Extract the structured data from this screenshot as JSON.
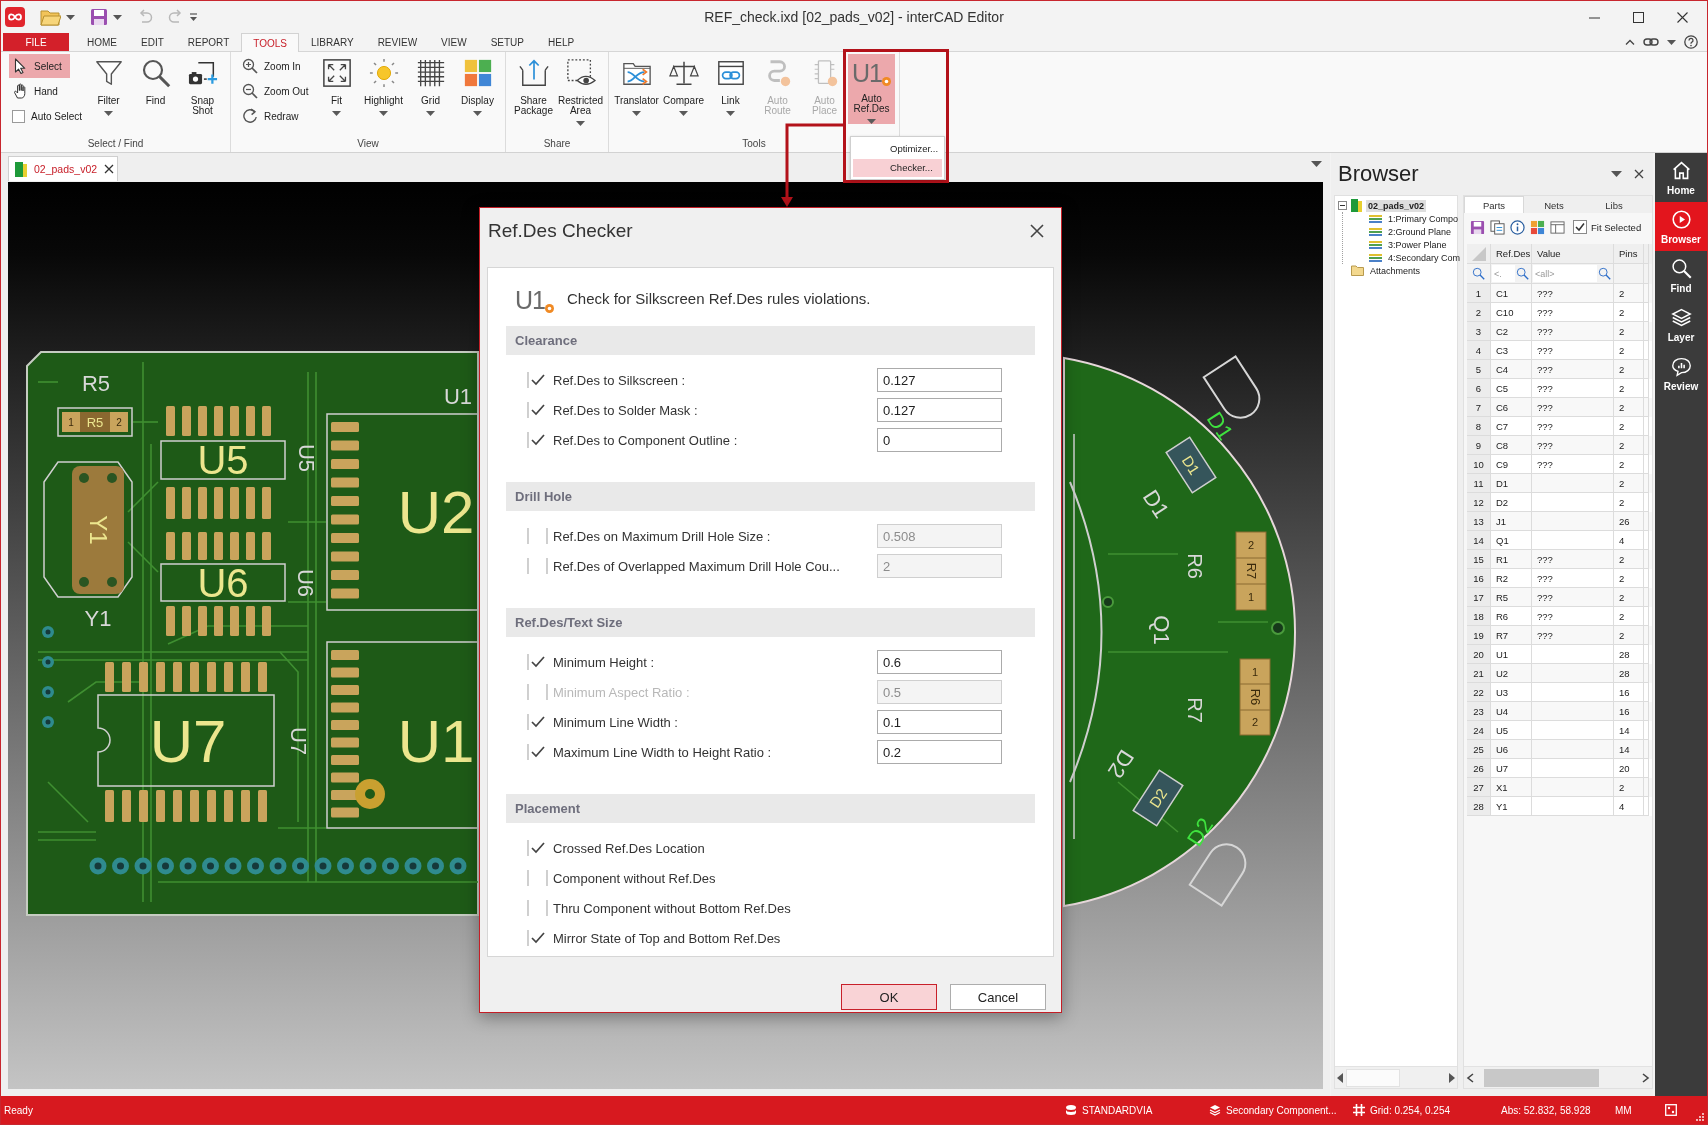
{
  "window": {
    "title": "REF_check.ixd [02_pads_v02] - interCAD Editor"
  },
  "quick_access": {
    "undo": {
      "disabled": true
    },
    "redo": {
      "disabled": true
    }
  },
  "ribbon_tabs": [
    {
      "label": "FILE",
      "kind": "file",
      "selected": false
    },
    {
      "label": "HOME",
      "kind": "tab",
      "selected": false
    },
    {
      "label": "EDIT",
      "kind": "tab",
      "selected": false
    },
    {
      "label": "REPORT",
      "kind": "tab",
      "selected": false
    },
    {
      "label": "TOOLS",
      "kind": "tab",
      "selected": true
    },
    {
      "label": "LIBRARY",
      "kind": "tab",
      "selected": false
    },
    {
      "label": "REVIEW",
      "kind": "tab",
      "selected": false
    },
    {
      "label": "VIEW",
      "kind": "tab",
      "selected": false
    },
    {
      "label": "SETUP",
      "kind": "tab",
      "selected": false
    },
    {
      "label": "HELP",
      "kind": "tab",
      "selected": false
    }
  ],
  "ribbon_groups": [
    {
      "label": "Select / Find",
      "items": [
        {
          "kind": "small",
          "label": "Select",
          "selected": true
        },
        {
          "kind": "small",
          "label": "Hand",
          "selected": false
        },
        {
          "kind": "checkbox",
          "label": "Auto Select",
          "checked": false
        },
        {
          "kind": "large",
          "label": "Filter",
          "dropdown": true,
          "expanded": false,
          "disabled": false
        },
        {
          "kind": "large",
          "label": "Find",
          "dropdown": false,
          "expanded": false,
          "disabled": false
        },
        {
          "kind": "large",
          "label": "Snap Shot",
          "dropdown": false,
          "expanded": false,
          "disabled": false
        }
      ]
    },
    {
      "label": "View",
      "items": [
        {
          "kind": "small",
          "label": "Zoom In"
        },
        {
          "kind": "small",
          "label": "Zoom Out"
        },
        {
          "kind": "small",
          "label": "Redraw"
        },
        {
          "kind": "large",
          "label": "Fit",
          "dropdown": true,
          "expanded": false,
          "disabled": false
        },
        {
          "kind": "large",
          "label": "Highlight",
          "dropdown": true,
          "expanded": false,
          "disabled": false
        },
        {
          "kind": "large",
          "label": "Grid",
          "dropdown": true,
          "expanded": false,
          "disabled": false
        },
        {
          "kind": "large",
          "label": "Display",
          "dropdown": true,
          "expanded": false,
          "disabled": false
        }
      ]
    },
    {
      "label": "Share",
      "items": [
        {
          "kind": "large",
          "label": "Share Package",
          "dropdown": false,
          "expanded": false,
          "disabled": false
        },
        {
          "kind": "large",
          "label": "Restricted Area",
          "dropdown": true,
          "expanded": false,
          "disabled": false
        }
      ]
    },
    {
      "label": "Tools",
      "items": [
        {
          "kind": "large",
          "label": "Translator",
          "dropdown": true,
          "expanded": false,
          "disabled": false
        },
        {
          "kind": "large",
          "label": "Compare",
          "dropdown": true,
          "expanded": false,
          "disabled": false
        },
        {
          "kind": "large",
          "label": "Link",
          "dropdown": true,
          "expanded": false,
          "disabled": false
        },
        {
          "kind": "large",
          "label": "Auto Route",
          "dropdown": false,
          "expanded": false,
          "disabled": true
        },
        {
          "kind": "large",
          "label": "Auto Place",
          "dropdown": false,
          "expanded": false,
          "disabled": true
        },
        {
          "kind": "large",
          "label": "Auto Ref.Des",
          "glyph": "U1",
          "dropdown": true,
          "expanded": true,
          "disabled": false
        }
      ]
    }
  ],
  "ref_des_menu": {
    "items": [
      {
        "label": "Optimizer...",
        "selected": false
      },
      {
        "label": "Checker...",
        "selected": true
      }
    ]
  },
  "document_tabs": [
    {
      "label": "02_pads_v02",
      "selected": true
    }
  ],
  "board_labels": [
    {
      "text": "R5",
      "kind": "silkscreen"
    },
    {
      "text": "1",
      "kind": "pad"
    },
    {
      "text": "R5",
      "kind": "assembly"
    },
    {
      "text": "2",
      "kind": "pad"
    },
    {
      "text": "U5",
      "kind": "assembly"
    },
    {
      "text": "U5",
      "kind": "silkscreen"
    },
    {
      "text": "U1",
      "kind": "silkscreen"
    },
    {
      "text": "U2",
      "kind": "assembly"
    },
    {
      "text": "Y1",
      "kind": "assembly"
    },
    {
      "text": "Y1",
      "kind": "silkscreen"
    },
    {
      "text": "U6",
      "kind": "assembly"
    },
    {
      "text": "U6",
      "kind": "silkscreen"
    },
    {
      "text": "U7",
      "kind": "assembly"
    },
    {
      "text": "U7",
      "kind": "silkscreen"
    },
    {
      "text": "U1",
      "kind": "assembly"
    },
    {
      "text": "D1",
      "kind": "highlight"
    },
    {
      "text": "D1",
      "kind": "assembly"
    },
    {
      "text": "D1",
      "kind": "silkscreen"
    },
    {
      "text": "R6",
      "kind": "silkscreen"
    },
    {
      "text": "2",
      "kind": "pad"
    },
    {
      "text": "R7",
      "kind": "pad"
    },
    {
      "text": "1",
      "kind": "pad"
    },
    {
      "text": "Q1",
      "kind": "silkscreen"
    },
    {
      "text": "1",
      "kind": "pad"
    },
    {
      "text": "R6",
      "kind": "pad"
    },
    {
      "text": "2",
      "kind": "pad"
    },
    {
      "text": "R7",
      "kind": "silkscreen"
    },
    {
      "text": "D2",
      "kind": "silkscreen"
    },
    {
      "text": "D2",
      "kind": "assembly"
    },
    {
      "text": "D2",
      "kind": "highlight"
    }
  ],
  "dialog": {
    "title": "Ref.Des Checker",
    "glyph": "U1",
    "intro": "Check for Silkscreen Ref.Des rules violations.",
    "sections": [
      {
        "title": "Clearance",
        "rules": [
          {
            "label": "Ref.Des to Silkscreen :",
            "checked": true,
            "disabled": false,
            "value": "0.127"
          },
          {
            "label": "Ref.Des to Solder Mask :",
            "checked": true,
            "disabled": false,
            "value": "0.127"
          },
          {
            "label": "Ref.Des to Component Outline :",
            "checked": true,
            "disabled": false,
            "value": "0"
          }
        ]
      },
      {
        "title": "Drill Hole",
        "rules": [
          {
            "label": "Ref.Des on Maximum Drill Hole Size :",
            "checked": false,
            "disabled": false,
            "value": "0.508"
          },
          {
            "label": "Ref.Des of Overlapped Maximum Drill Hole Cou...",
            "checked": false,
            "disabled": false,
            "value": "2"
          }
        ]
      },
      {
        "title": "Ref.Des/Text Size",
        "rules": [
          {
            "label": "Minimum Height :",
            "checked": true,
            "disabled": false,
            "value": "0.6"
          },
          {
            "label": "Minimum Aspect Ratio :",
            "checked": false,
            "disabled": true,
            "value": "0.5"
          },
          {
            "label": "Minimum Line Width :",
            "checked": true,
            "disabled": false,
            "value": "0.1"
          },
          {
            "label": "Maximum Line Width to Height Ratio :",
            "checked": true,
            "disabled": false,
            "value": "0.2"
          }
        ]
      },
      {
        "title": "Placement",
        "rules": [
          {
            "label": "Crossed Ref.Des Location",
            "checked": true,
            "disabled": false
          },
          {
            "label": "Component without Ref.Des",
            "checked": false,
            "disabled": false
          },
          {
            "label": "Thru Component without Bottom Ref.Des",
            "checked": false,
            "disabled": false
          },
          {
            "label": "Mirror State of Top and Bottom Ref.Des",
            "checked": true,
            "disabled": false
          }
        ]
      }
    ],
    "buttons": [
      {
        "label": "OK",
        "kind": "primary"
      },
      {
        "label": "Cancel",
        "kind": "secondary"
      }
    ]
  },
  "browser": {
    "title": "Browser",
    "tree": [
      {
        "label": "02_pads_v02",
        "kind": "document",
        "selected": true,
        "expanded": true,
        "children": [
          {
            "label": "1:Primary Compo",
            "kind": "layer",
            "selected": false
          },
          {
            "label": "2:Ground Plane",
            "kind": "layer",
            "selected": false
          },
          {
            "label": "3:Power Plane",
            "kind": "layer",
            "selected": false
          },
          {
            "label": "4:Secondary Com",
            "kind": "layer",
            "selected": false
          }
        ]
      },
      {
        "label": "Attachments",
        "kind": "folder",
        "selected": false
      }
    ],
    "tabs": [
      {
        "label": "Parts",
        "selected": true
      },
      {
        "label": "Nets",
        "selected": false
      },
      {
        "label": "Libs",
        "selected": false
      }
    ],
    "fit_selected": {
      "label": "Fit Selected",
      "checked": true
    },
    "table": {
      "columns": [
        "Ref.Des",
        "Value",
        "Pins"
      ],
      "filters": [
        {
          "placeholder": "<."
        },
        {
          "placeholder": "<all>"
        }
      ],
      "rows": [
        {
          "number": "1",
          "ref_des": "C1",
          "value": "???",
          "pins": "2"
        },
        {
          "number": "2",
          "ref_des": "C10",
          "value": "???",
          "pins": "2"
        },
        {
          "number": "3",
          "ref_des": "C2",
          "value": "???",
          "pins": "2"
        },
        {
          "number": "4",
          "ref_des": "C3",
          "value": "???",
          "pins": "2"
        },
        {
          "number": "5",
          "ref_des": "C4",
          "value": "???",
          "pins": "2"
        },
        {
          "number": "6",
          "ref_des": "C5",
          "value": "???",
          "pins": "2"
        },
        {
          "number": "7",
          "ref_des": "C6",
          "value": "???",
          "pins": "2"
        },
        {
          "number": "8",
          "ref_des": "C7",
          "value": "???",
          "pins": "2"
        },
        {
          "number": "9",
          "ref_des": "C8",
          "value": "???",
          "pins": "2"
        },
        {
          "number": "10",
          "ref_des": "C9",
          "value": "???",
          "pins": "2"
        },
        {
          "number": "11",
          "ref_des": "D1",
          "pins": "2"
        },
        {
          "number": "12",
          "ref_des": "D2",
          "pins": "2"
        },
        {
          "number": "13",
          "ref_des": "J1",
          "pins": "26"
        },
        {
          "number": "14",
          "ref_des": "Q1",
          "pins": "4"
        },
        {
          "number": "15",
          "ref_des": "R1",
          "value": "???",
          "pins": "2"
        },
        {
          "number": "16",
          "ref_des": "R2",
          "value": "???",
          "pins": "2"
        },
        {
          "number": "17",
          "ref_des": "R5",
          "value": "???",
          "pins": "2"
        },
        {
          "number": "18",
          "ref_des": "R6",
          "value": "???",
          "pins": "2"
        },
        {
          "number": "19",
          "ref_des": "R7",
          "value": "???",
          "pins": "2"
        },
        {
          "number": "20",
          "ref_des": "U1",
          "pins": "28"
        },
        {
          "number": "21",
          "ref_des": "U2",
          "pins": "28"
        },
        {
          "number": "22",
          "ref_des": "U3",
          "pins": "16"
        },
        {
          "number": "23",
          "ref_des": "U4",
          "pins": "16"
        },
        {
          "number": "24",
          "ref_des": "U5",
          "pins": "14"
        },
        {
          "number": "25",
          "ref_des": "U6",
          "pins": "14"
        },
        {
          "number": "26",
          "ref_des": "U7",
          "pins": "20"
        },
        {
          "number": "27",
          "ref_des": "X1",
          "pins": "2"
        },
        {
          "number": "28",
          "ref_des": "Y1",
          "pins": "4"
        }
      ]
    }
  },
  "side_nav": [
    {
      "label": "Home",
      "selected": false
    },
    {
      "label": "Browser",
      "selected": true
    },
    {
      "label": "Find",
      "selected": false
    },
    {
      "label": "Layer",
      "selected": false
    },
    {
      "label": "Review",
      "selected": false
    }
  ],
  "status_bar": {
    "message": "Ready",
    "items": [
      "STANDARDVIA",
      "Secondary Component...",
      "Grid: 0.254, 0.254",
      "Abs: 52.832, 58.928",
      "MM"
    ]
  }
}
